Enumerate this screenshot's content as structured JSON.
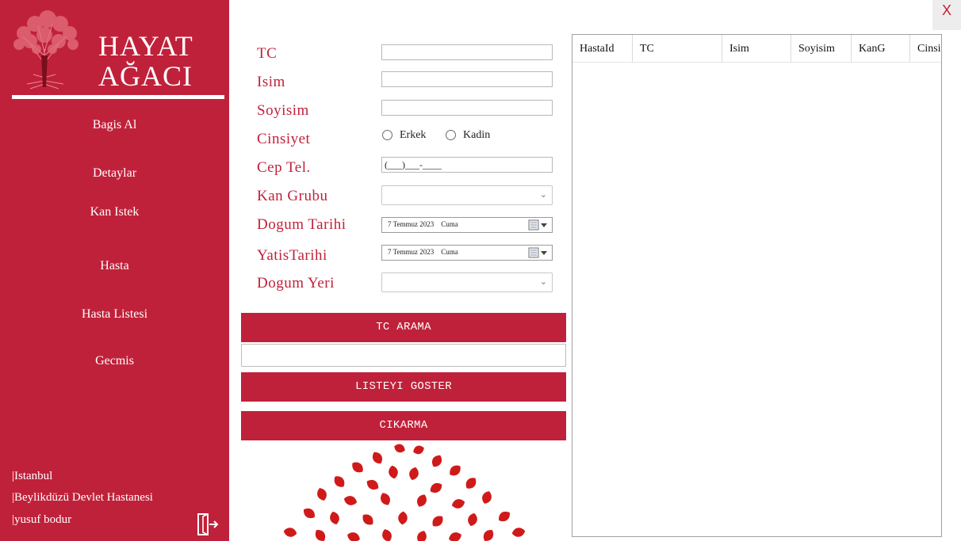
{
  "app": {
    "brand_line1": "HAYAT",
    "brand_line2": "AĞACI",
    "close_label": "X"
  },
  "sidebar": {
    "items": [
      {
        "label": "Bagis Al"
      },
      {
        "label": "Detaylar"
      },
      {
        "label": "Kan Istek"
      },
      {
        "label": "Hasta"
      },
      {
        "label": "Hasta Listesi"
      },
      {
        "label": "Gecmis"
      }
    ],
    "footer": {
      "city": "|Istanbul",
      "hospital": "|Beylikdüzü Devlet Hastanesi",
      "user": "|yusuf bodur"
    },
    "exit_icon": "door-exit-icon"
  },
  "form": {
    "labels": {
      "tc": "TC",
      "isim": "Isim",
      "soyisim": "Soyisim",
      "cinsiyet": "Cinsiyet",
      "cep_tel": "Cep Tel.",
      "kan_grubu": "Kan Grubu",
      "dogum_tarihi": "Dogum Tarihi",
      "yatis_tarihi": "YatisTarihi",
      "dogum_yeri": "Dogum Yeri"
    },
    "values": {
      "tc": "",
      "isim": "",
      "soyisim": "",
      "cep_tel_mask": "(___)___-____",
      "kan_grubu": "",
      "dogum_yeri": ""
    },
    "gender_options": [
      "Erkek",
      "Kadin"
    ],
    "dogum_tarihi": "7 Temmuz 2023    Cuma",
    "yatis_tarihi": "7 Temmuz 2023    Cuma",
    "tc_search_value": ""
  },
  "buttons": {
    "tc_arama": "TC ARAMA",
    "listeyi_goster": "LISTEYI GOSTER",
    "cikarma": "CIKARMA"
  },
  "table": {
    "columns": [
      "HastaId",
      "TC",
      "Isim",
      "Soyisim",
      "KanG",
      "Cinsi"
    ],
    "rows": []
  },
  "colors": {
    "brand_red": "#c0213a",
    "white": "#ffffff"
  }
}
